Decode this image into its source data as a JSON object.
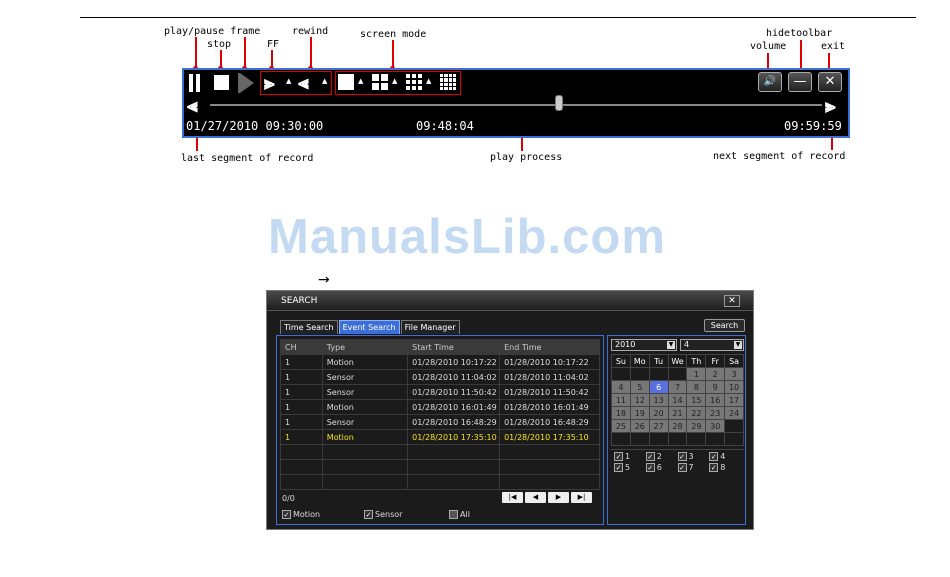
{
  "callouts": {
    "play_pause_frame": "play/pause frame",
    "stop": "stop",
    "ff": "FF",
    "rewind": "rewind",
    "screen_mode": "screen mode",
    "hide_toolbar": "hidetoolbar",
    "volume": "volume",
    "exit": "exit",
    "last_segment": "last segment of record",
    "play_process": "play process",
    "next_segment": "next segment of record"
  },
  "toolbar": {
    "start_time": "01/27/2010  09:30:00",
    "current_time": "09:48:04",
    "end_time": "09:59:59",
    "exit_glyph": "✕",
    "volume_glyph": "🔊",
    "hide_glyph": "—",
    "playback_progress": 0.57
  },
  "watermark": "ManualsLib.com",
  "arrow_glyph": "→",
  "search_window": {
    "title": "SEARCH",
    "close_glyph": "✕",
    "tabs": [
      {
        "label": "Time Search",
        "active": false
      },
      {
        "label": "Event Search",
        "active": true
      },
      {
        "label": "File Manager",
        "active": false
      }
    ],
    "search_button": "Search",
    "columns": [
      "CH",
      "Type",
      "Start Time",
      "End Time"
    ],
    "rows": [
      {
        "ch": "1",
        "type": "Motion",
        "start": "01/28/2010  10:17:22",
        "end": "01/28/2010  10:17:22"
      },
      {
        "ch": "1",
        "type": "Sensor",
        "start": "01/28/2010  11:04:02",
        "end": "01/28/2010  11:04:02"
      },
      {
        "ch": "1",
        "type": "Sensor",
        "start": "01/28/2010  11:50:42",
        "end": "01/28/2010  11:50:42"
      },
      {
        "ch": "1",
        "type": "Motion",
        "start": "01/28/2010  16:01:49",
        "end": "01/28/2010  16:01:49"
      },
      {
        "ch": "1",
        "type": "Sensor",
        "start": "01/28/2010  16:48:29",
        "end": "01/28/2010  16:48:29"
      },
      {
        "ch": "1",
        "type": "Motion",
        "start": "01/28/2010  17:35:10",
        "end": "01/28/2010  17:35:10"
      }
    ],
    "highlight_row": 5,
    "count": "0/0",
    "pager": [
      "|◀",
      "◀",
      "▶",
      "▶|"
    ],
    "filters": [
      {
        "label": "Motion",
        "checked": true
      },
      {
        "label": "Sensor",
        "checked": true
      },
      {
        "label": "All",
        "checked": false
      }
    ],
    "year": "2010",
    "month": "4",
    "weekdays": [
      "Su",
      "Mo",
      "Tu",
      "We",
      "Th",
      "Fr",
      "Sa"
    ],
    "calendar": [
      [
        "",
        "",
        "",
        "",
        "1",
        "2",
        "3"
      ],
      [
        "4",
        "5",
        "6",
        "7",
        "8",
        "9",
        "10"
      ],
      [
        "11",
        "12",
        "13",
        "14",
        "15",
        "16",
        "17"
      ],
      [
        "18",
        "19",
        "20",
        "21",
        "22",
        "23",
        "24"
      ],
      [
        "25",
        "26",
        "27",
        "28",
        "29",
        "30",
        ""
      ],
      [
        "",
        "",
        "",
        "",
        "",
        "",
        ""
      ]
    ],
    "selected_day": "6",
    "channels": [
      "1",
      "2",
      "3",
      "4",
      "5",
      "6",
      "7",
      "8"
    ],
    "check_glyph": "✓"
  }
}
